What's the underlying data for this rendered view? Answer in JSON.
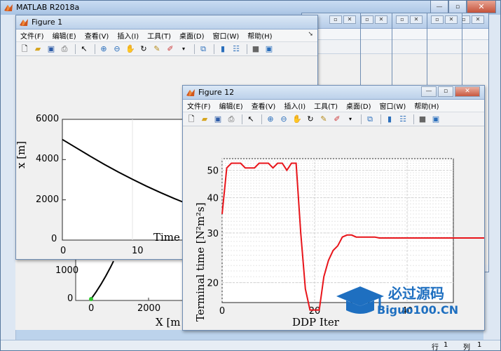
{
  "app": {
    "title": "MATLAB R2018a"
  },
  "main_status": {
    "row_label": "行",
    "row_value": "1",
    "col_label": "列",
    "col_value": "1"
  },
  "figure1": {
    "title": "Figure 1",
    "menus": [
      "文件(F)",
      "编辑(E)",
      "查看(V)",
      "插入(I)",
      "工具(T)",
      "桌面(D)",
      "窗口(W)",
      "帮助(H)"
    ],
    "chart_data": {
      "type": "line",
      "ylabel": "x [m]",
      "xlabel": "Time",
      "y_ticks": [
        "0",
        "2000",
        "4000",
        "6000"
      ],
      "x_ticks": [
        "0",
        "10"
      ],
      "ylim": [
        0,
        6000
      ],
      "series": [
        {
          "x": [
            0,
            2,
            4,
            6,
            8,
            10,
            12,
            14,
            16,
            18,
            20
          ],
          "y": [
            5000,
            4580,
            4160,
            3760,
            3380,
            3020,
            2680,
            2360,
            2060,
            1780,
            1520
          ]
        }
      ]
    }
  },
  "behind_plot": {
    "y_ticks": [
      "0",
      "1000"
    ],
    "x_ticks": [
      "0",
      "2000"
    ],
    "xlabel": "X [m"
  },
  "figure12": {
    "title": "Figure 12",
    "menus": [
      "文件(F)",
      "编辑(E)",
      "查看(V)",
      "插入(I)",
      "工具(T)",
      "桌面(D)",
      "窗口(W)",
      "帮助(H)"
    ],
    "chart_data": {
      "type": "line",
      "ylabel": "Terminal time [N²m²s]",
      "xlabel": "DDP Iter",
      "y_scale": "log",
      "y_ticks": [
        "20",
        "30",
        "40",
        "50"
      ],
      "x_ticks": [
        "0",
        "20",
        "40"
      ],
      "xlim": [
        0,
        50
      ],
      "ylim": [
        17,
        55
      ],
      "grid": true,
      "color": "#e8141a",
      "series": [
        {
          "x": [
            0,
            1,
            2,
            3,
            4,
            5,
            6,
            7,
            8,
            9,
            10,
            11,
            12,
            13,
            14,
            15,
            16,
            17,
            18,
            19,
            20,
            21,
            22,
            23,
            24,
            25,
            26,
            27,
            28,
            29,
            30,
            31,
            32,
            33,
            34,
            35,
            40,
            45,
            50,
            55,
            60,
            62
          ],
          "y": [
            35,
            51,
            53,
            53,
            53,
            51,
            51,
            51,
            53,
            53,
            53,
            51,
            53,
            53,
            50,
            53,
            53,
            30,
            19,
            16,
            16,
            16,
            21,
            24,
            26,
            27,
            29,
            29.5,
            29.5,
            29,
            29,
            29,
            29,
            29,
            28.8,
            28.8,
            28.8,
            28.8,
            28.8,
            28.8,
            28.8,
            28.8
          ]
        }
      ]
    }
  },
  "watermark": {
    "line1": "必过源码",
    "line2": "Biguo100.CN"
  },
  "colors": {
    "series_black": "#000000",
    "series_red": "#e8141a",
    "accent": "#2a6ebb"
  }
}
